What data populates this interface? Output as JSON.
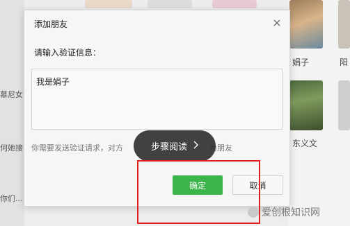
{
  "dialog": {
    "title": "添加朋友",
    "prompt": "请输入验证信息：",
    "message_value": "我是娟子",
    "hint": "你需要发送验证请求，对方",
    "hint_tail": "为朋友",
    "ok_label": "确定",
    "cancel_label": "取消"
  },
  "toast": {
    "label": "步骤阅读"
  },
  "background": {
    "left_labels": [
      "慕尼女",
      "何她接",
      "你们..."
    ],
    "right_labels": [
      "娟子",
      "阳",
      "东义文"
    ]
  },
  "watermark": {
    "text": "爱创根知识网"
  },
  "colors": {
    "accent_green": "#3bb54a",
    "highlight_red": "#e21d1d"
  }
}
